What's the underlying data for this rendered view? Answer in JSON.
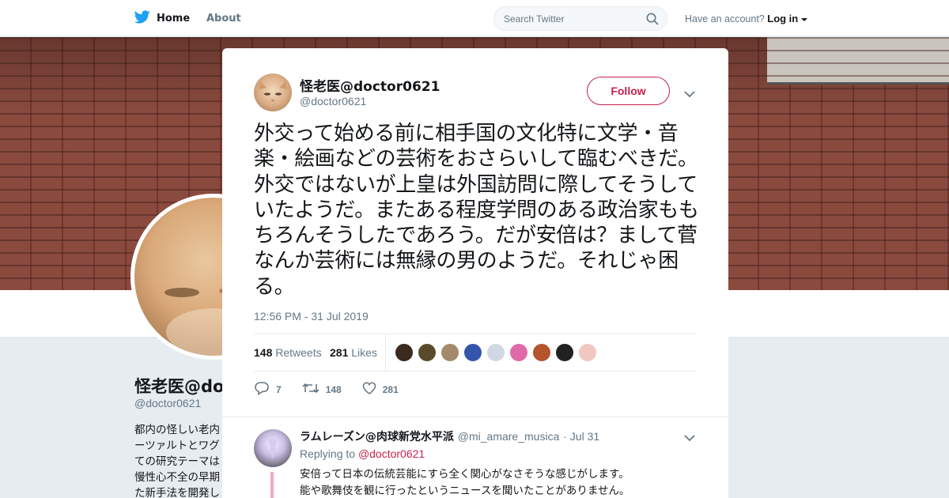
{
  "nav": {
    "home": "Home",
    "about": "About",
    "search_placeholder": "Search Twitter",
    "account_text": "Have an account?",
    "login": "Log in"
  },
  "profile": {
    "name": "怪老医@doc",
    "handle": "@doctor0621",
    "bio": [
      "都内の怪しい老内",
      "ーツァルトとワグ",
      "ての研究テーマは",
      "慢性心不全の早期",
      "た新手法を開発し"
    ]
  },
  "tweet": {
    "display_name": "怪老医@doctor0621",
    "handle": "@doctor0621",
    "follow_label": "Follow",
    "text": "外交って始める前に相手国の文化特に文学・音楽・絵画などの芸術をおさらいして臨むべきだ。外交ではないが上皇は外国訪問に際してそうしていたようだ。またある程度学問のある政治家ももちろんそうしたであろう。だが安倍は？まして菅なんか芸術には無縁の男のようだ。それじゃ困る。",
    "timestamp": "12:56 PM - 31 Jul 2019",
    "retweets_count": "148",
    "retweets_label": "Retweets",
    "likes_count": "281",
    "likes_label": "Likes",
    "actions": {
      "reply_count": "7",
      "retweet_count": "148",
      "like_count": "281"
    }
  },
  "likers": [
    "#3b2a1f",
    "#5a4a2c",
    "#a48a6a",
    "#3355aa",
    "#cfd8e3",
    "#e06aa8",
    "#b4552e",
    "#222222",
    "#f0c8c0"
  ],
  "reply": {
    "display_name": "ラムレーズン@肉球新党水平派",
    "handle": "@mi_amare_musica",
    "date": "· Jul 31",
    "replying_to_label": "Replying to",
    "replying_to_handle": "@doctor0621",
    "line1": "安倍って日本の伝統芸能にすら全く関心がなさそうな感じがします。",
    "line2": "能や歌舞伎を観に行ったというニュースを聞いたことがありません。"
  },
  "colors": {
    "accent": "#c6234b",
    "twitter_blue": "#1da1f2"
  }
}
